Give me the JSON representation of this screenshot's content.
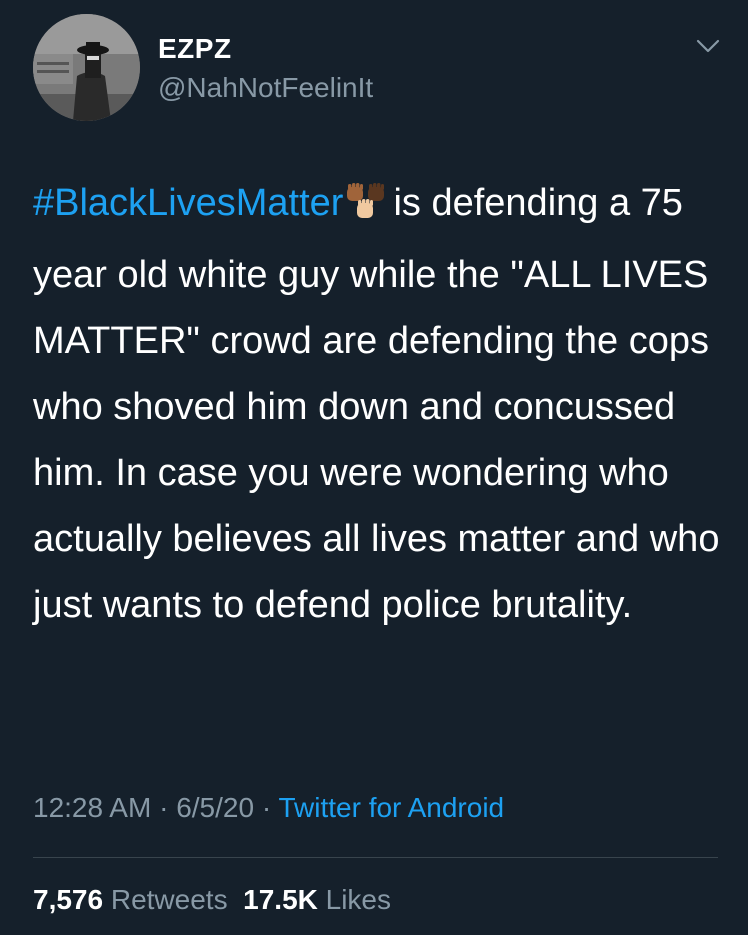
{
  "author": {
    "display_name": "EZPZ",
    "handle": "@NahNotFeelinIt"
  },
  "tweet": {
    "hashtag": "#BlackLivesMatter",
    "emoji": "raised-fists-emoji",
    "text_after_hashtag": "is defending a 75 year old white guy while the \"ALL LIVES MATTER\" crowd are defending the cops who shoved him down and concussed him. In case you were wondering who actually believes all lives matter and who just wants to defend police brutality."
  },
  "meta": {
    "time": "12:28 AM",
    "separator": " · ",
    "date": "6/5/20",
    "source": "Twitter for Android"
  },
  "stats": {
    "retweets_count": "7,576",
    "retweets_label": "Retweets",
    "likes_count": "17.5K",
    "likes_label": "Likes"
  },
  "colors": {
    "background": "#15202b",
    "link": "#1da1f2",
    "secondary_text": "#8899a6",
    "divider": "#38444d"
  }
}
